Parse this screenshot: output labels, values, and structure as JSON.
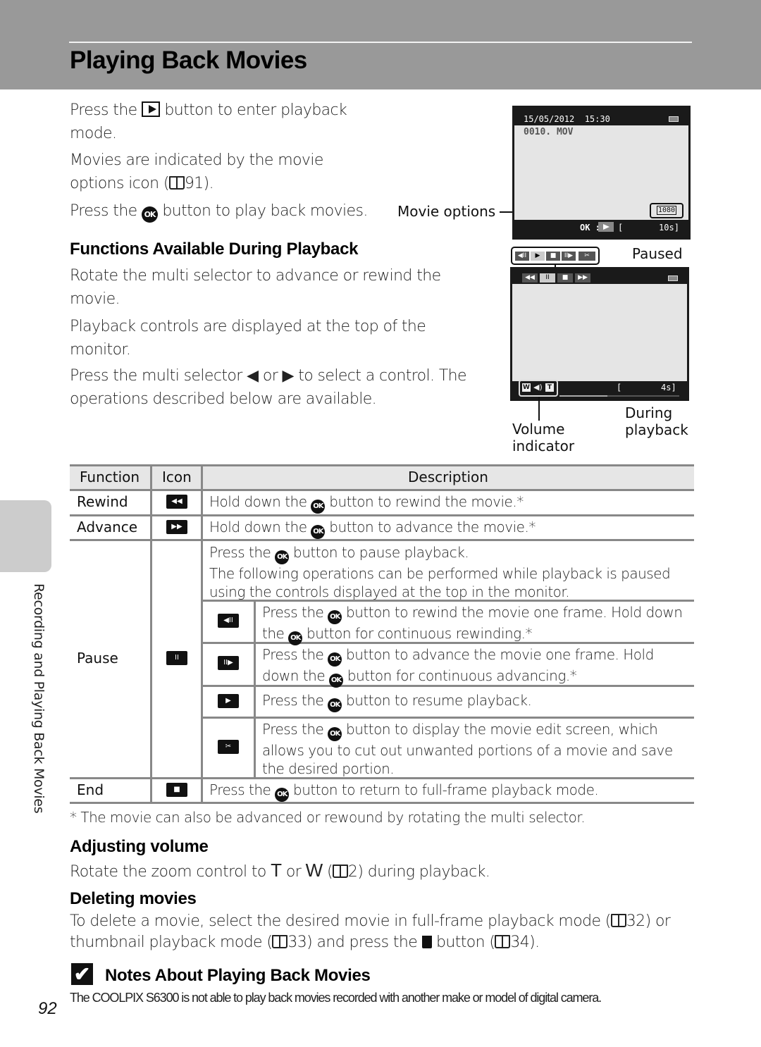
{
  "page": {
    "title": "Playing Back Movies",
    "side_tab": "Recording and Playing Back Movies",
    "page_number": "92"
  },
  "intro": {
    "p1_a": "Press the",
    "p1_icon": "playback-button-icon",
    "p1_b": "button to enter playback",
    "p1_c": "mode.",
    "p2_a": "Movies are indicated by the movie",
    "p2_b": "options icon (",
    "p2_ref": "91",
    "p2_c": ").",
    "p3_a": "Press the",
    "p3_icon": "ok-button-icon",
    "p3_b": "button to play back movies."
  },
  "icons": {
    "ok": "OK",
    "reference": "book-reference-icon",
    "delete": "trash-icon"
  },
  "screen1": {
    "date": "15/05/2012",
    "time": "15:30",
    "filename": "0010. MOV",
    "movie_option": "1080",
    "bottom_hint": "OK :",
    "remaining": "10s",
    "callout_label": "Movie options"
  },
  "screen2": {
    "label_paused": "Paused",
    "paused_controls": [
      "◀II",
      "▶",
      "■",
      "II▶",
      "✂"
    ],
    "playback_controls": [
      "◀◀",
      "II",
      "■",
      "▶▶"
    ],
    "volume_w": "W",
    "volume_t": "T",
    "elapsed": "4s",
    "progress_fraction": 0.4,
    "label_during_1": "During",
    "label_during_2": "playback",
    "label_volume_1": "Volume",
    "label_volume_2": "indicator"
  },
  "functions": {
    "heading": "Functions Available During Playback",
    "p1_a": "Rotate the multi selector to advance or rewind the",
    "p1_b": "movie.",
    "p2_a": "Playback controls are displayed at the top of the",
    "p2_b": "monitor.",
    "p3_a": "Press the multi selector",
    "p3_left": "◀",
    "p3_or": "or",
    "p3_right": "▶",
    "p3_b": "to select a control. The",
    "p3_c": "operations described below are available."
  },
  "table": {
    "headers": [
      "Function",
      "Icon",
      "Description"
    ],
    "rows": [
      {
        "function": "Rewind",
        "icon": "◀◀",
        "desc_a": "Hold down the",
        "desc_b": "button to rewind the movie.*"
      },
      {
        "function": "Advance",
        "icon": "▶▶",
        "desc_a": "Hold down the",
        "desc_b": "button to advance the movie.*"
      },
      {
        "function": "Pause",
        "icon": "II",
        "desc_a": "Press the",
        "desc_b": "button to pause playback.",
        "desc_c": "The following operations can be performed while playback is paused",
        "desc_d": "using the controls displayed at the top in the monitor.",
        "sub": [
          {
            "icon": "◀II",
            "l1a": "Press the",
            "l1b": "button to rewind the movie one frame. Hold down",
            "l2a": "the",
            "l2b": "button for continuous rewinding.*"
          },
          {
            "icon": "II▶",
            "l1a": "Press the",
            "l1b": "button to advance the movie one frame. Hold",
            "l2a": "down the",
            "l2b": "button for continuous advancing.*"
          },
          {
            "icon": "▶",
            "l1a": "Press the",
            "l1b": "button to resume playback."
          },
          {
            "icon": "✂",
            "l1a": "Press the",
            "l1b": "button to display the movie edit screen, which",
            "l2": "allows you to cut out unwanted portions of a movie and save",
            "l3": "the desired portion."
          }
        ]
      },
      {
        "function": "End",
        "icon": "■",
        "desc_a": "Press the",
        "desc_b": "button to return to full-frame playback mode."
      }
    ],
    "footnote": "*  The movie can also be advanced or rewound by rotating the multi selector."
  },
  "volume": {
    "heading": "Adjusting volume",
    "text_a": "Rotate the zoom control to",
    "t": "T",
    "or": "or",
    "w": "W",
    "text_b": "(",
    "ref": "2",
    "text_c": ") during playback."
  },
  "deleting": {
    "heading": "Deleting movies",
    "l1_a": "To delete a movie, select the desired movie in full-frame playback mode (",
    "l1_ref": "32",
    "l1_b": ") or",
    "l2_a": "thumbnail playback mode (",
    "l2_ref": "33",
    "l2_b": ") and press the",
    "l2_c": "button (",
    "l2_ref2": "34",
    "l2_d": ")."
  },
  "notes": {
    "icon": "✔",
    "heading": "Notes About Playing Back Movies",
    "text": "The COOLPIX S6300 is not able to play back movies recorded with another make or model of digital camera."
  }
}
